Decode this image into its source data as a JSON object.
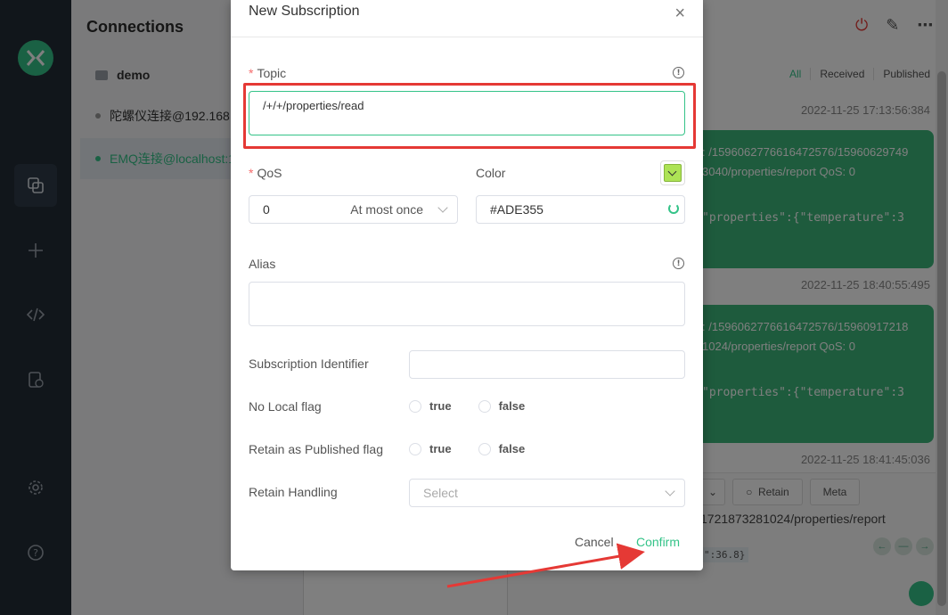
{
  "sidebar_connections": {
    "title": "Connections",
    "items": [
      {
        "label": "demo",
        "type": "folder"
      },
      {
        "label": "陀螺仪连接@192.168...",
        "type": "connection",
        "active": false
      },
      {
        "label": "EMQ连接@localhost:1",
        "type": "connection",
        "active": true
      }
    ]
  },
  "messages": {
    "filters": [
      "All",
      "Received",
      "Published"
    ],
    "items": [
      {
        "time": "2022-11-25 17:13:56:384",
        "topic_line1": ": /1596062776616472576/15960629749",
        "topic_line2": "3040/properties/report     QoS: 0",
        "payload": "\"properties\":{\"temperature\":3"
      },
      {
        "time": "2022-11-25 18:40:55:495",
        "topic_line1": ": /1596062776616472576/15960917218",
        "topic_line2": "1024/properties/report     QoS: 0",
        "payload": "\"properties\":{\"temperature\":3"
      }
    ],
    "last_time": "2022-11-25 18:41:45:036",
    "publish": {
      "retain_label": "Retain",
      "meta_label": "Meta",
      "topic": "1721873281024/properties/report",
      "payload_tail": "\":36.8}"
    }
  },
  "dialog": {
    "title": "New Subscription",
    "close": "×",
    "topic": {
      "label": "Topic",
      "value": "/+/+/properties/read"
    },
    "qos": {
      "label": "QoS",
      "value": "0",
      "description": "At most once"
    },
    "color": {
      "label": "Color",
      "value": "#ADE355",
      "swatch": "#ADE355"
    },
    "alias": {
      "label": "Alias",
      "value": ""
    },
    "subscription_identifier": {
      "label": "Subscription Identifier",
      "value": ""
    },
    "no_local": {
      "label": "No Local flag",
      "true_label": "true",
      "false_label": "false"
    },
    "retain_as_published": {
      "label": "Retain as Published flag",
      "true_label": "true",
      "false_label": "false"
    },
    "retain_handling": {
      "label": "Retain Handling",
      "placeholder": "Select"
    },
    "buttons": {
      "cancel": "Cancel",
      "confirm": "Confirm"
    }
  },
  "colors": {
    "accent": "#34c388",
    "annotation": "#e53935",
    "message_bubble": "#3cb77a",
    "rail": "#232c36"
  }
}
